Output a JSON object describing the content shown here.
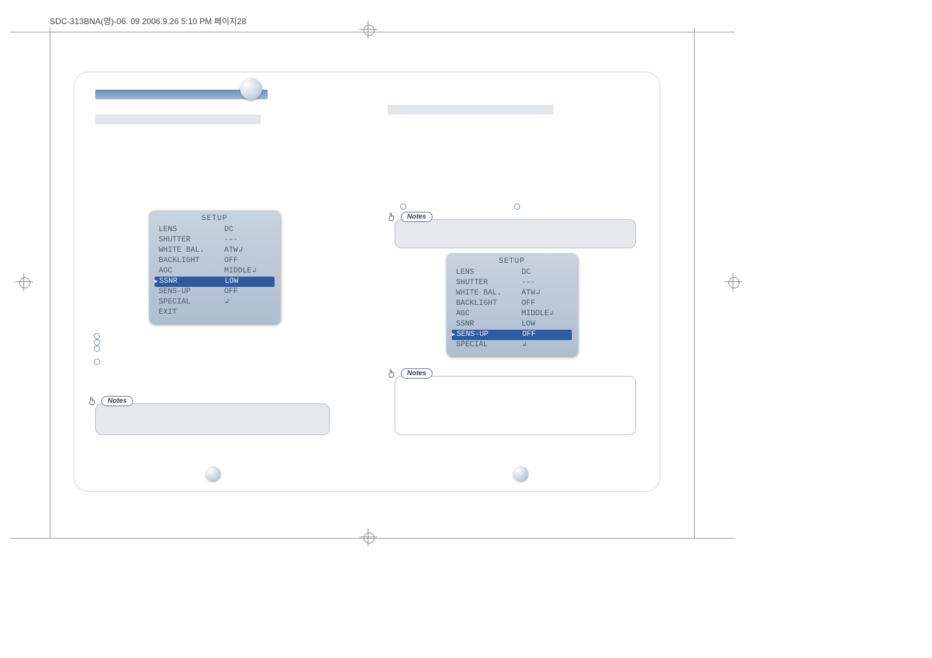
{
  "header": "SDC-313BNA(영)-06. 09  2006.9.26 5:10 PM  페이지28",
  "left": {
    "setup": {
      "title": "SETUP",
      "rows": [
        {
          "k": "LENS",
          "v": "DC"
        },
        {
          "k": "SHUTTER",
          "v": "---"
        },
        {
          "k": "WHITE BAL.",
          "v": "ATW",
          "enter": true
        },
        {
          "k": "BACKLIGHT",
          "v": "OFF"
        },
        {
          "k": "AGC",
          "v": "MIDDLE",
          "enter": true
        },
        {
          "k": "SSNR",
          "v": "LOW",
          "sel": true
        },
        {
          "k": "SENS-UP",
          "v": "OFF"
        },
        {
          "k": "SPECIAL",
          "v": "",
          "enter": true
        },
        {
          "k": "EXIT",
          "v": ""
        }
      ]
    },
    "bullets": [
      "",
      "",
      "",
      ""
    ],
    "notes_label": "Notes"
  },
  "right": {
    "top_bullets": [
      "",
      ""
    ],
    "notes1_label": "Notes",
    "setup": {
      "title": "SETUP",
      "rows": [
        {
          "k": "LENS",
          "v": "DC"
        },
        {
          "k": "SHUTTER",
          "v": "---"
        },
        {
          "k": "WHITE BAL.",
          "v": "ATW",
          "enter": true
        },
        {
          "k": "BACKLIGHT",
          "v": "OFF"
        },
        {
          "k": "AGC",
          "v": "MIDDLE",
          "enter": true
        },
        {
          "k": "SSNR",
          "v": "LOW"
        },
        {
          "k": "SENS-UP",
          "v": "OFF",
          "sel": true
        },
        {
          "k": "SPECIAL",
          "v": "",
          "enter": true
        }
      ]
    },
    "notes2_label": "Notes"
  },
  "page_left_num": "",
  "page_right_num": ""
}
